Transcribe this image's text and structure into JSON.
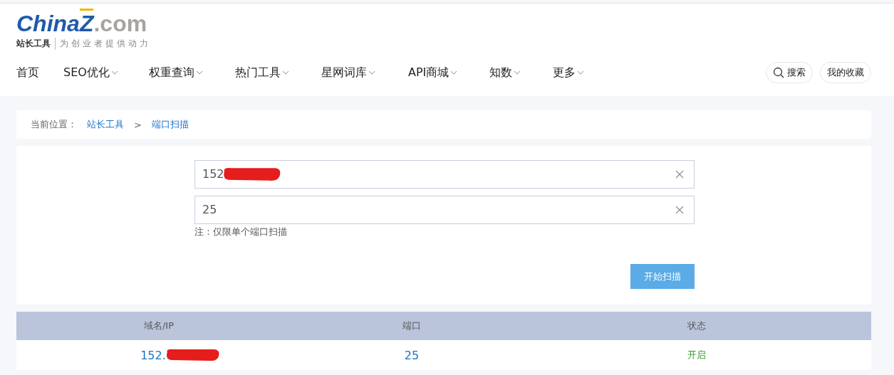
{
  "logo": {
    "brand": "China",
    "mark": "Z",
    "domain": ".com",
    "site": "站长工具",
    "slogan": "为创业者提供动力"
  },
  "nav": [
    {
      "label": "首页",
      "dropdown": false
    },
    {
      "label": "SEO优化",
      "dropdown": true
    },
    {
      "label": "权重查询",
      "dropdown": true
    },
    {
      "label": "热门工具",
      "dropdown": true
    },
    {
      "label": "星网词库",
      "dropdown": true
    },
    {
      "label": "API商城",
      "dropdown": true
    },
    {
      "label": "知数",
      "dropdown": true
    },
    {
      "label": "更多",
      "dropdown": true
    }
  ],
  "search_button": "搜索",
  "favorites_button": "我的收藏",
  "breadcrumb": {
    "label": "当前位置：",
    "items": [
      "站长工具",
      "端口扫描"
    ],
    "separator": ">"
  },
  "form": {
    "fields": [
      {
        "value": "152",
        "redacted": true
      },
      {
        "value": "25",
        "redacted": false
      }
    ],
    "note": "注：仅限单个端口扫描",
    "submit": "开始扫描"
  },
  "table": {
    "columns": [
      "域名/IP",
      "端口",
      "状态"
    ],
    "rows": [
      {
        "host": "152.",
        "host_redacted": true,
        "port": "25",
        "status": "开启"
      }
    ]
  }
}
